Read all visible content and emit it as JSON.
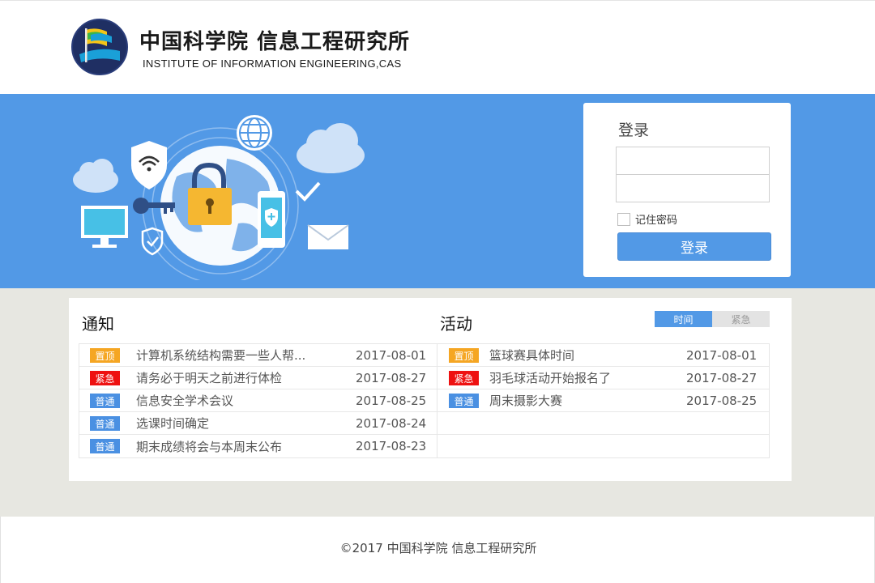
{
  "header": {
    "title_cn": "中国科学院 信息工程研究所",
    "title_en": "INSTITUTE OF INFORMATION ENGINEERING,CAS"
  },
  "login": {
    "title": "登录",
    "username_placeholder": "",
    "password_placeholder": "",
    "remember_label": "记住密码",
    "submit_label": "登录"
  },
  "notices": {
    "title": "通知",
    "items": [
      {
        "badge": "置顶",
        "badge_color": "#f5a623",
        "title": "计算机系统结构需要一些人帮...",
        "date": "2017-08-01"
      },
      {
        "badge": "紧急",
        "badge_color": "#ee1111",
        "title": "请务必于明天之前进行体检",
        "date": "2017-08-27"
      },
      {
        "badge": "普通",
        "badge_color": "#4a90e2",
        "title": "信息安全学术会议",
        "date": "2017-08-25"
      },
      {
        "badge": "普通",
        "badge_color": "#4a90e2",
        "title": "选课时间确定",
        "date": "2017-08-24"
      },
      {
        "badge": "普通",
        "badge_color": "#4a90e2",
        "title": "期末成绩将会与本周末公布",
        "date": "2017-08-23"
      }
    ]
  },
  "activities": {
    "title": "活动",
    "tabs": [
      {
        "label": "时间",
        "active": true
      },
      {
        "label": "紧急",
        "active": false
      }
    ],
    "items": [
      {
        "badge": "置顶",
        "badge_color": "#f5a623",
        "title": "篮球赛具体时间",
        "date": "2017-08-01"
      },
      {
        "badge": "紧急",
        "badge_color": "#ee1111",
        "title": "羽毛球活动开始报名了",
        "date": "2017-08-27"
      },
      {
        "badge": "普通",
        "badge_color": "#4a90e2",
        "title": "周末摄影大赛",
        "date": "2017-08-25"
      },
      {
        "badge": "",
        "badge_color": "",
        "title": "",
        "date": ""
      },
      {
        "badge": "",
        "badge_color": "",
        "title": "",
        "date": ""
      }
    ]
  },
  "footer": {
    "copyright": "©2017 中国科学院 信息工程研究所"
  },
  "colors": {
    "accent": "#5299e6",
    "pinned": "#f5a623",
    "urgent": "#ee1111",
    "normal": "#4a90e2"
  }
}
